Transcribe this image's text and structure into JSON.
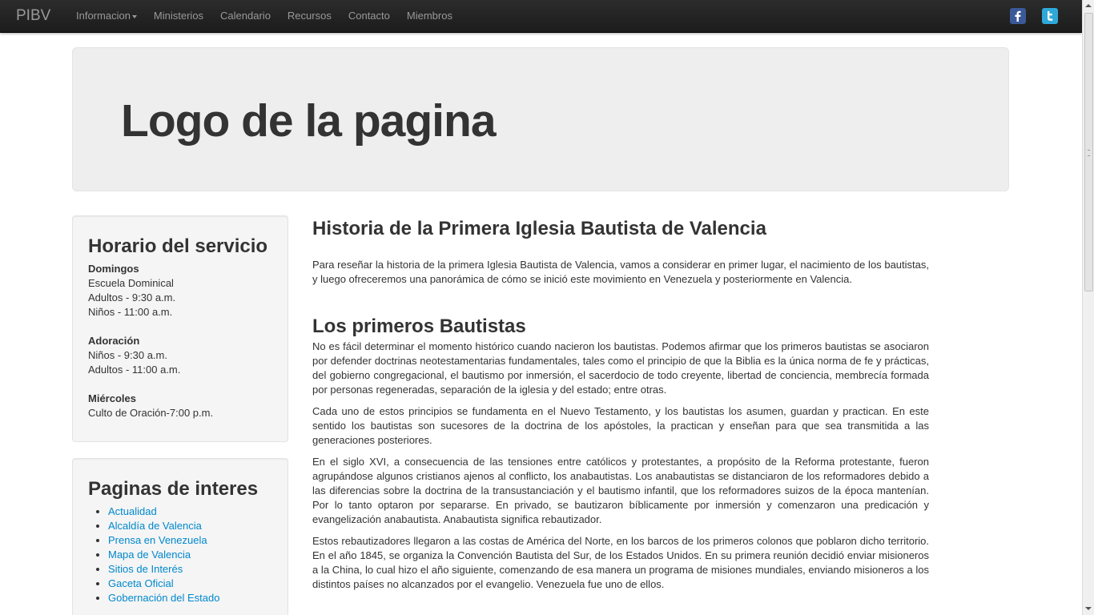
{
  "navbar": {
    "brand": "PIBV",
    "items": [
      {
        "label": "Informacion",
        "dropdown": true
      },
      {
        "label": "Ministerios"
      },
      {
        "label": "Calendario"
      },
      {
        "label": "Recursos"
      },
      {
        "label": "Contacto"
      },
      {
        "label": "Miembros"
      }
    ],
    "social": [
      "facebook-icon",
      "twitter-icon"
    ]
  },
  "hero": {
    "title": "Logo de la pagina"
  },
  "horario": {
    "title": "Horario del servicio",
    "groups": [
      {
        "day": "Domingos",
        "lines": [
          "Escuela Dominical",
          "Adultos - 9:30 a.m.",
          "Niños - 11:00 a.m."
        ]
      },
      {
        "day": "Adoración",
        "lines": [
          "Niños - 9:30 a.m.",
          "Adultos - 11:00 a.m."
        ]
      },
      {
        "day": "Miércoles",
        "lines": [
          "Culto de Oración-7:00 p.m."
        ]
      }
    ]
  },
  "paginas": {
    "title": "Paginas de interes",
    "links": [
      "Actualidad",
      "Alcaldía de Valencia",
      "Prensa en Venezuela",
      "Mapa de Valencia",
      "Sitios de Interés",
      "Gaceta Oficial",
      "Gobernación del Estado"
    ]
  },
  "main": {
    "heading1": "Historia de la Primera Iglesia Bautista de Valencia",
    "intro": "Para reseñar la historia de la primera Iglesia Bautista de Valencia, vamos a considerar en primer lugar, el nacimiento de los bautistas, y luego ofreceremos una panorámica de cómo se inició este movimiento en Venezuela y posteriormente en Valencia.",
    "heading2": "Los primeros Bautistas",
    "paragraphs": [
      "No es fácil determinar el momento histórico cuando nacieron los bautistas. Podemos afirmar que los primeros bautistas se asociaron por defender doctrinas neotestamentarias fundamentales, tales como el principio de que la Biblia es la única norma de fe y prácticas, del gobierno congregacional, el bautismo por inmersión, el sacerdocio de todo creyente, libertad de conciencia, membrecía formada por personas regeneradas, separación de la iglesia y del estado; entre otras.",
      "Cada uno de estos principios se fundamenta en el Nuevo Testamento, y los bautistas los asumen, guardan y practican. En este sentido los bautistas son sucesores de la doctrina de los apóstoles, la practican y enseñan para que sea transmitida a las generaciones posteriores.",
      "En el siglo XVI, a consecuencia de las tensiones entre católicos y protestantes, a propósito de la Reforma protestante, fueron agrupándose algunos cristianos ajenos al conflicto, los anabautistas. Los anabautistas se distanciaron de los reformadores debido a las diferencias sobre la doctrina de la transustanciación y el bautismo infantil, que los reformadores suizos de la época mantenían. Por lo tanto optaron por separarse. En privado, se bautizaron bíblicamente por inmersión y comenzaron una predicación y evangelización anabautista. Anabautista significa rebautizador.",
      "Estos rebautizadores llegaron a las costas de América del Norte, en los barcos de los primeros colonos que poblaron dicho territorio. En el año 1845, se organiza la Convención Bautista del Sur, de los Estados Unidos. En su primera reunión decidió enviar misioneros a la China, lo cual hizo el año siguiente, comenzando de esa manera un programa de misiones mundiales, enviando misioneros a los distintos países no alcanzados por el evangelio. Venezuela fue uno de ellos."
    ]
  }
}
